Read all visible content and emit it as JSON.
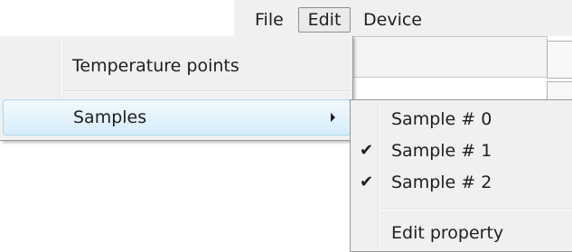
{
  "menubar": {
    "items": [
      {
        "label": "File"
      },
      {
        "label": "Edit"
      },
      {
        "label": "Device"
      }
    ]
  },
  "edit_menu": {
    "items": [
      {
        "label": "Temperature points"
      },
      {
        "label": "Samples"
      }
    ]
  },
  "samples_submenu": {
    "items": [
      {
        "label": "Sample # 0",
        "checked": false
      },
      {
        "label": "Sample # 1",
        "checked": true
      },
      {
        "label": "Sample # 2",
        "checked": true
      },
      {
        "label": "Edit property"
      }
    ],
    "check_glyph": "✔"
  },
  "colors": {
    "menu_background": "#f0f0f0",
    "highlight_border": "#a8d8eb",
    "highlight_fill": "#d6eefb",
    "text": "#1e1e1e"
  }
}
